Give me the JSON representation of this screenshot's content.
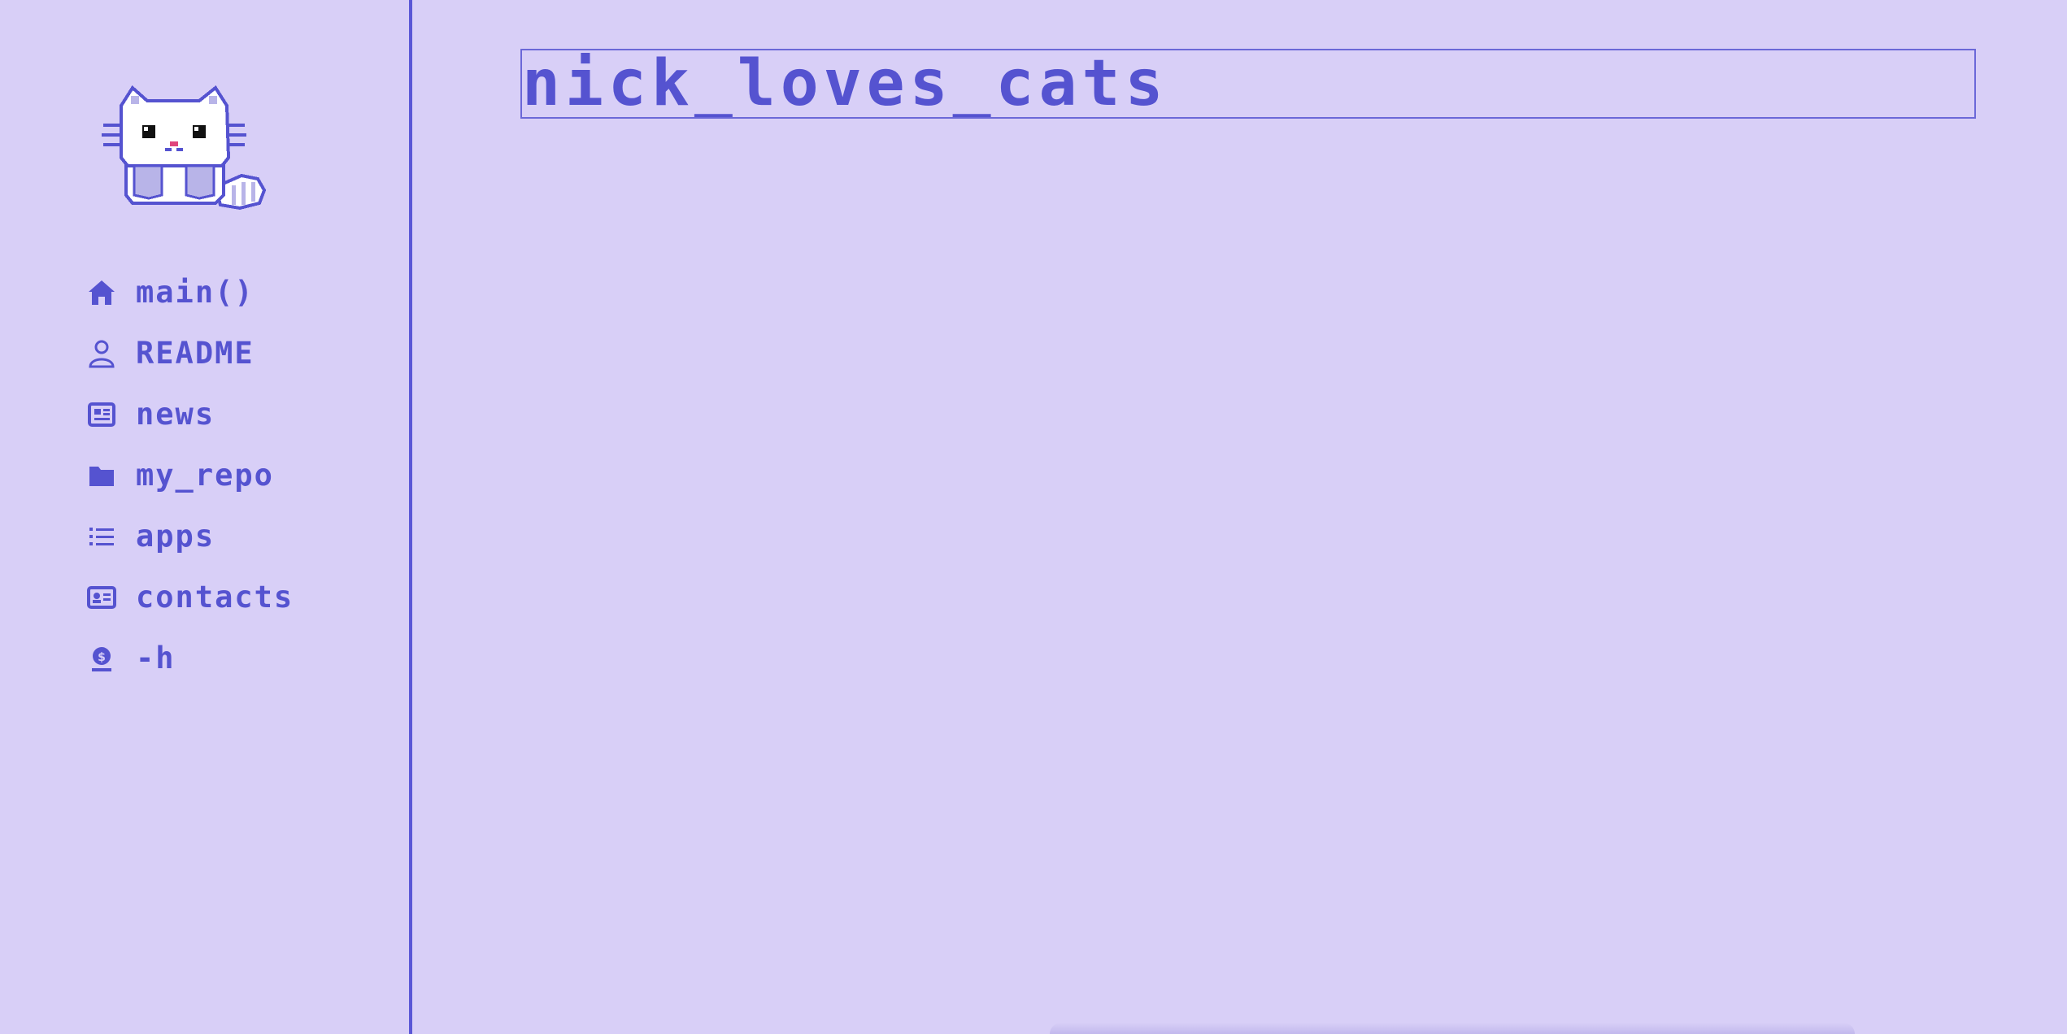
{
  "header": {
    "title": "nick_loves_cats"
  },
  "sidebar": {
    "logo_icon": "pixel-cat-icon",
    "items": [
      {
        "label": "main()",
        "icon": "home-icon"
      },
      {
        "label": "README",
        "icon": "user-icon"
      },
      {
        "label": "news",
        "icon": "newspaper-icon"
      },
      {
        "label": "my_repo",
        "icon": "folder-icon"
      },
      {
        "label": "apps",
        "icon": "list-icon"
      },
      {
        "label": "contacts",
        "icon": "contact-card-icon"
      },
      {
        "label": "-h",
        "icon": "help-icon"
      }
    ]
  },
  "colors": {
    "background": "#d8cff7",
    "accent": "#5553d0",
    "border": "#5a57d6"
  }
}
